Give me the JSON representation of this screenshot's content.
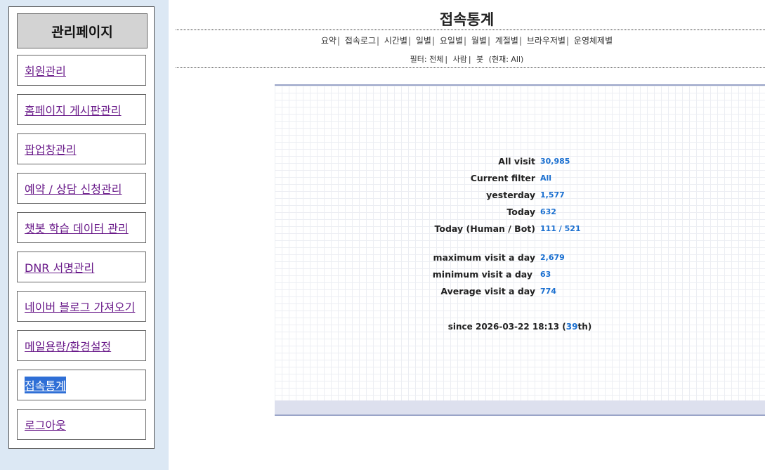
{
  "sidebar": {
    "title": "관리페이지",
    "items": [
      {
        "label": "회원관리"
      },
      {
        "label": "홈페이지 게시판관리"
      },
      {
        "label": "팝업창관리"
      },
      {
        "label": "예약 / 상담 신청관리"
      },
      {
        "label": "챗봇 학습 데이터 관리"
      },
      {
        "label": "DNR 서명관리"
      },
      {
        "label": "네이버 블로그 가져오기"
      },
      {
        "label": "메일용량/환경설정"
      },
      {
        "label": "접속통계"
      },
      {
        "label": "로그아웃"
      }
    ],
    "selected_index": 8
  },
  "header": {
    "title": "접속통계",
    "nav": [
      "요약",
      "접속로그",
      "시간별",
      "일별",
      "요일별",
      "월별",
      "계절별",
      "브라우저별",
      "운영체제별"
    ],
    "filter": {
      "label": "필터:",
      "options": [
        "전체",
        "사람",
        "봇"
      ],
      "current": "(현재: All)"
    }
  },
  "stats": {
    "all_visit_label": "All visit",
    "all_visit_value": "30,985",
    "current_filter_label": "Current filter",
    "current_filter_value": "All",
    "yesterday_label": "yesterday",
    "yesterday_value": "1,577",
    "today_label": "Today",
    "today_value": "632",
    "today_hb_label": "Today (Human / Bot)",
    "today_hb_value": "111 / 521",
    "max_label": "maximum visit a day",
    "max_value": "2,679",
    "min_label": "minimum visit a day",
    "min_value": "63",
    "avg_label": "Average visit a day",
    "avg_value": "774",
    "since_prefix": "since 2026-03-22 18:13 (",
    "since_days": "39",
    "since_suffix": "th)"
  },
  "colors": {
    "link_purple": "#6a1b8a",
    "value_blue": "#1a6fd0",
    "sidebar_bg": "#dce8f4",
    "selected_bg": "#2f6fd6"
  }
}
